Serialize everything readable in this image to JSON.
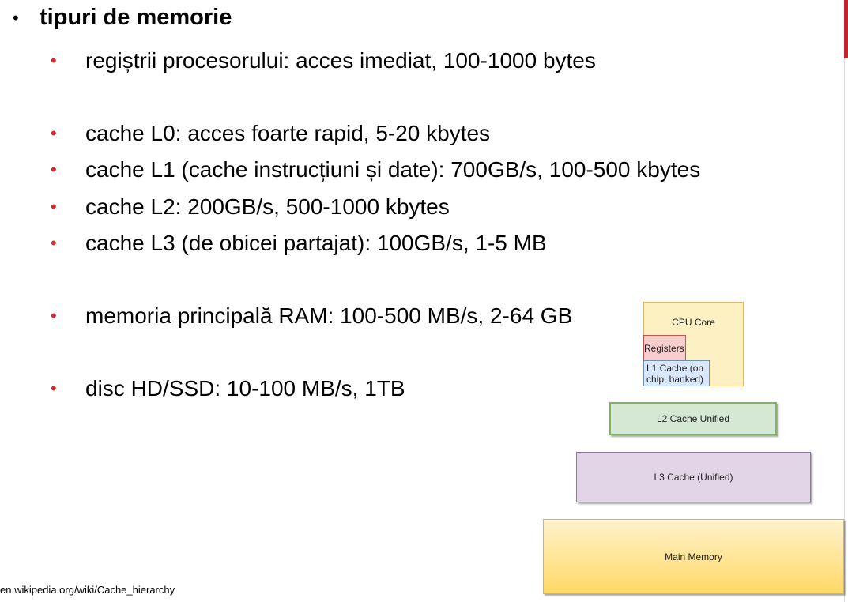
{
  "heading": {
    "bullet": "•",
    "text": "tipuri de memorie"
  },
  "items": [
    {
      "text": "regiștrii procesorului: acces imediat, 100-1000 bytes"
    },
    {
      "text": "cache L0: acces foarte rapid, 5-20 kbytes"
    },
    {
      "text": "cache L1 (cache instrucțiuni și date): 700GB/s, 100-500 kbytes"
    },
    {
      "text": "cache L2: 200GB/s, 500-1000 kbytes"
    },
    {
      "text": "cache L3 (de obicei partajat): 100GB/s, 1-5 MB"
    },
    {
      "text": "memoria principală RAM: 100-500 MB/s, 2-64 GB"
    },
    {
      "text": "disc HD/SSD: 10-100 MB/s, 1TB"
    }
  ],
  "item_bullet": "•",
  "bullet_color": "#d42b2b",
  "diagram": {
    "cpu_core": "CPU Core",
    "registers": "Registers",
    "l1_cache": "L1 Cache (on chip, banked)",
    "l2_cache": "L2 Cache Unified",
    "l3_cache": "L3 Cache (Unified)",
    "main_memory": "Main Memory",
    "colors": {
      "cpu_core": "#fdf0c2",
      "registers": "#f8cecc",
      "l1_cache": "#dae8fc",
      "l2_cache": "#d5e8d4",
      "l3_cache": "#e1d5e7",
      "main_memory": "#ffd966"
    }
  },
  "source": "en.wikipedia.org/wiki/Cache_hierarchy",
  "accent_color": "#c0262d"
}
